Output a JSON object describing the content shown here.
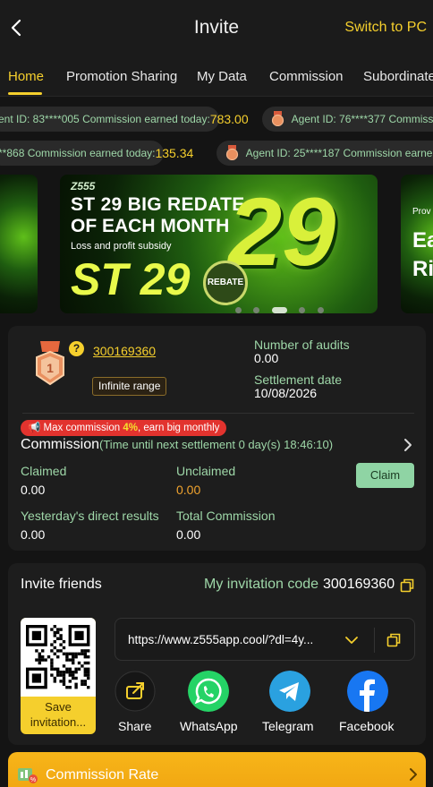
{
  "header": {
    "title": "Invite",
    "switch_label": "Switch to PC"
  },
  "tabs": [
    "Home",
    "Promotion Sharing",
    "My Data",
    "Commission",
    "Subordinate"
  ],
  "ticker_row1": [
    {
      "agent": "ent ID: 83****005",
      "label": "Commission earned today:",
      "value": "783.00"
    },
    {
      "agent": "Agent ID: 76****377",
      "label": "Commissi",
      "value": ""
    }
  ],
  "ticker_row2": [
    {
      "agent": "**868",
      "label": "Commission earned today:",
      "value": "135.34"
    },
    {
      "agent": "Agent ID: 25****187",
      "label": "Commission earned",
      "value": ""
    }
  ],
  "banner": {
    "logo": "Z555",
    "headline1": "ST 29 BIG REDATE",
    "headline2": "OF EACH MONTH",
    "subtitle": "Loss and profit subsidy",
    "big": "ST 29",
    "number": "29",
    "badge": "REBATE",
    "right_small": "Prov",
    "right_line1": "Ear",
    "right_line2": "Ric"
  },
  "account": {
    "user_id": "300169360",
    "range": "Infinite range",
    "audits_label": "Number of audits",
    "audits_value": "0.00",
    "settlement_label": "Settlement date",
    "settlement_value": "10/08/2026"
  },
  "commission": {
    "badge_prefix": "Max commission ",
    "badge_highlight": "4%",
    "badge_suffix": ", earn big monthly",
    "title": "Commission",
    "subtitle": "(Time until next settlement  0 day(s) 18:46:10)",
    "claimed_label": "Claimed",
    "claimed_value": "0.00",
    "unclaimed_label": "Unclaimed",
    "unclaimed_value": "0.00",
    "claim_button": "Claim",
    "yesterday_label": "Yesterday's direct results",
    "yesterday_value": "0.00",
    "total_label": "Total Commission",
    "total_value": "0.00"
  },
  "invite": {
    "title": "Invite friends",
    "code_label": "My invitation code",
    "code": "300169360",
    "save_label": "Save invitation...",
    "url": "https://www.z555app.cool/?dl=4y...",
    "share_label": "Share",
    "whatsapp_label": "WhatsApp",
    "telegram_label": "Telegram",
    "facebook_label": "Facebook"
  },
  "rate_bar": {
    "label": "Commission Rate"
  },
  "colors": {
    "accent_yellow": "#f5cf2d",
    "label_green": "#9ed7a8",
    "orange": "#f0a32e",
    "badge_red": "#e2332e",
    "whatsapp": "#25d366",
    "telegram": "#2aa1e0",
    "facebook": "#1877f2"
  }
}
